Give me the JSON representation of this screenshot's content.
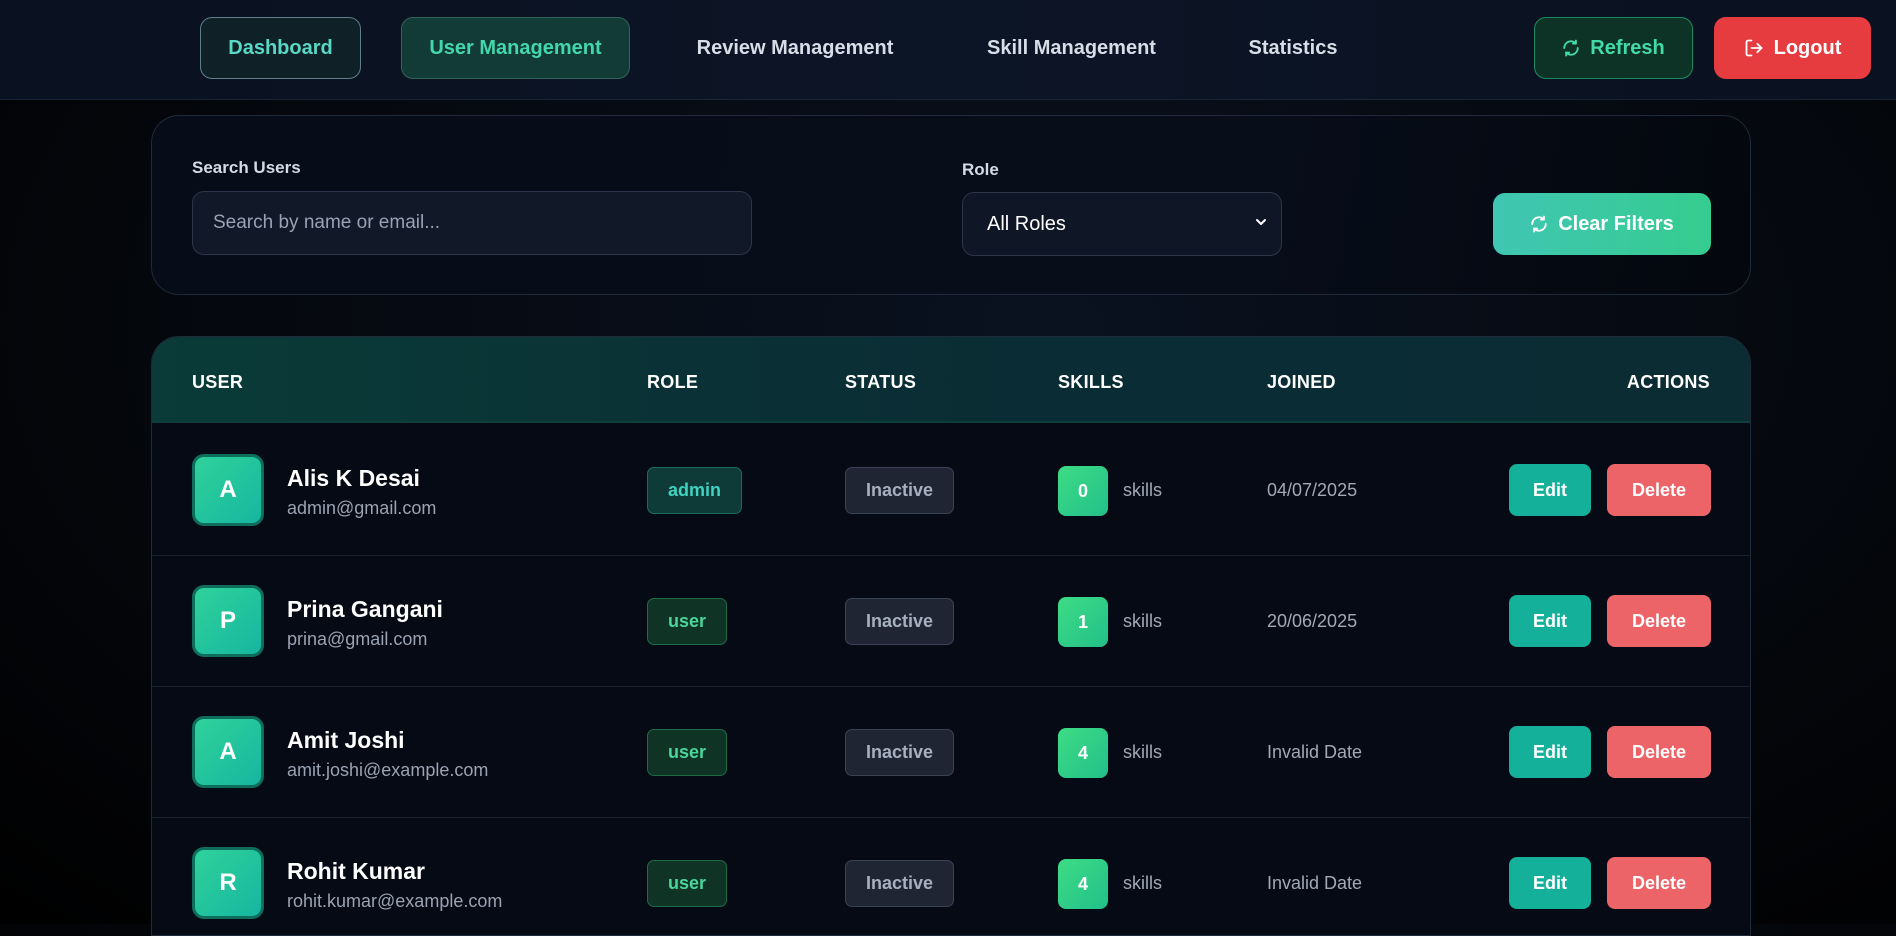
{
  "nav": {
    "dashboard": "Dashboard",
    "user_management": "User Management",
    "review_management": "Review Management",
    "skill_management": "Skill Management",
    "statistics": "Statistics",
    "refresh": "Refresh",
    "logout": "Logout"
  },
  "filters": {
    "search_label": "Search Users",
    "search_placeholder": "Search by name or email...",
    "search_value": "",
    "role_label": "Role",
    "role_selected": "All Roles",
    "clear_button": "Clear Filters"
  },
  "table": {
    "headers": [
      "USER",
      "ROLE",
      "STATUS",
      "SKILLS",
      "JOINED",
      "ACTIONS"
    ],
    "skills_suffix": "skills",
    "edit_label": "Edit",
    "delete_label": "Delete",
    "rows": [
      {
        "initial": "A",
        "name": "Alis K Desai",
        "email": "admin@gmail.com",
        "role": "admin",
        "status": "Inactive",
        "skills": "0",
        "joined": "04/07/2025"
      },
      {
        "initial": "P",
        "name": "Prina Gangani",
        "email": "prina@gmail.com",
        "role": "user",
        "status": "Inactive",
        "skills": "1",
        "joined": "20/06/2025"
      },
      {
        "initial": "A",
        "name": "Amit Joshi",
        "email": "amit.joshi@example.com",
        "role": "user",
        "status": "Inactive",
        "skills": "4",
        "joined": "Invalid Date"
      },
      {
        "initial": "R",
        "name": "Rohit Kumar",
        "email": "rohit.kumar@example.com",
        "role": "user",
        "status": "Inactive",
        "skills": "4",
        "joined": "Invalid Date"
      }
    ]
  },
  "colors": {
    "accent": "#14b09a",
    "danger": "#ec6468",
    "logout": "#e63b3f"
  },
  "icons": {
    "refresh": "refresh-icon",
    "logout": "logout-icon",
    "clear": "refresh-icon",
    "select": "chevron-down-icon"
  }
}
